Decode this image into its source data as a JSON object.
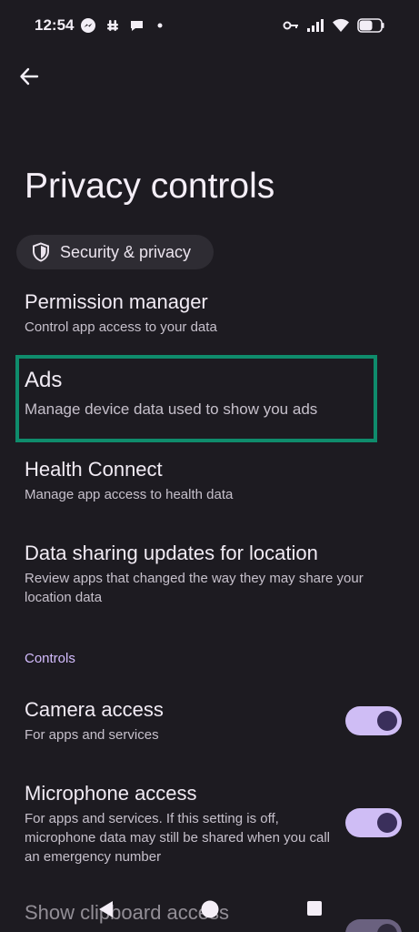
{
  "status_bar": {
    "time": "12:54",
    "left_icons": [
      "messenger-icon",
      "slack-icon",
      "chat-icon",
      "dot-icon"
    ],
    "right_icons": [
      "vpn-key-icon",
      "signal-icon",
      "wifi-icon",
      "battery-icon"
    ]
  },
  "header": {
    "title": "Privacy controls",
    "breadcrumb_label": "Security & privacy"
  },
  "items": [
    {
      "title": "Permission manager",
      "subtitle": "Control app access to your data"
    },
    {
      "title": "Ads",
      "subtitle": "Manage device data used to show you ads"
    },
    {
      "title": "Health Connect",
      "subtitle": "Manage app access to health data"
    },
    {
      "title": "Data sharing updates for location",
      "subtitle": "Review apps that changed the way they may share your location data"
    }
  ],
  "controls_section": {
    "header": "Controls",
    "items": [
      {
        "title": "Camera access",
        "subtitle": "For apps and services",
        "enabled": true
      },
      {
        "title": "Microphone access",
        "subtitle": "For apps and services. If this setting is off, microphone data may still be shared when you call an emergency number",
        "enabled": true
      },
      {
        "title": "Show clipboard access",
        "subtitle": "",
        "enabled": true
      }
    ]
  },
  "colors": {
    "background": "#1d1b21",
    "accent": "#d3bcfd",
    "highlight": "#0f8c6c",
    "toggle_track": "#cfbdf5"
  }
}
